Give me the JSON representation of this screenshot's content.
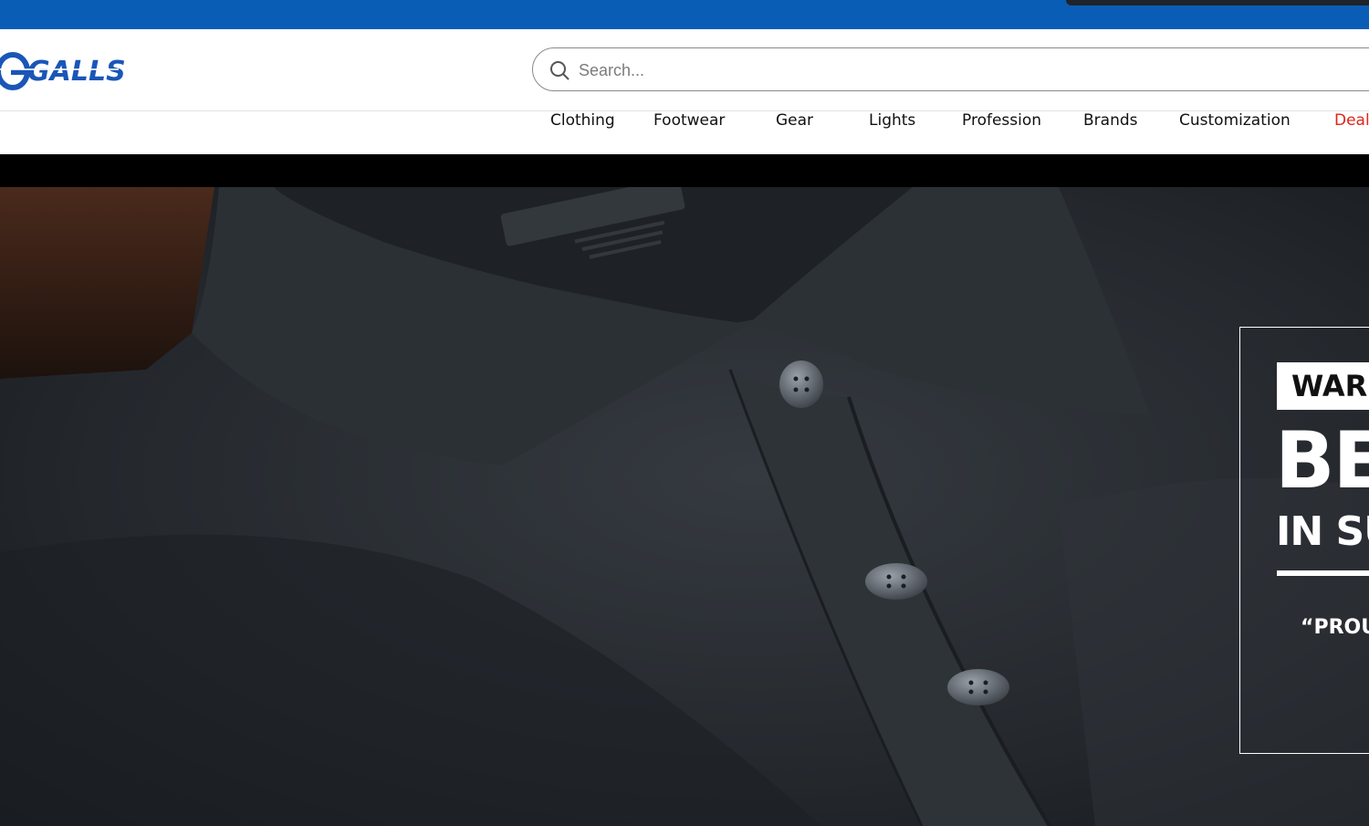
{
  "brand": {
    "logo_text": "GALLS",
    "color": "#1a56b8"
  },
  "colors": {
    "topbar": "#0a5db4",
    "accent_deals": "#e0251b",
    "hero_bg": "#23272c"
  },
  "search": {
    "placeholder": "Search...",
    "icon": "search-icon"
  },
  "nav": {
    "items": [
      {
        "label": "Clothing"
      },
      {
        "label": "Footwear"
      },
      {
        "label": "Gear"
      },
      {
        "label": "Lights"
      },
      {
        "label": "Profession"
      },
      {
        "label": "Brands"
      },
      {
        "label": "Customization"
      },
      {
        "label": "Deals"
      }
    ]
  },
  "hero": {
    "image": "black polo shirt close-up",
    "collar_print": "GALLS",
    "promo": {
      "tag": "WARM",
      "headline": "BE",
      "subhead": "IN SU",
      "quote": "“PROUD"
    }
  }
}
